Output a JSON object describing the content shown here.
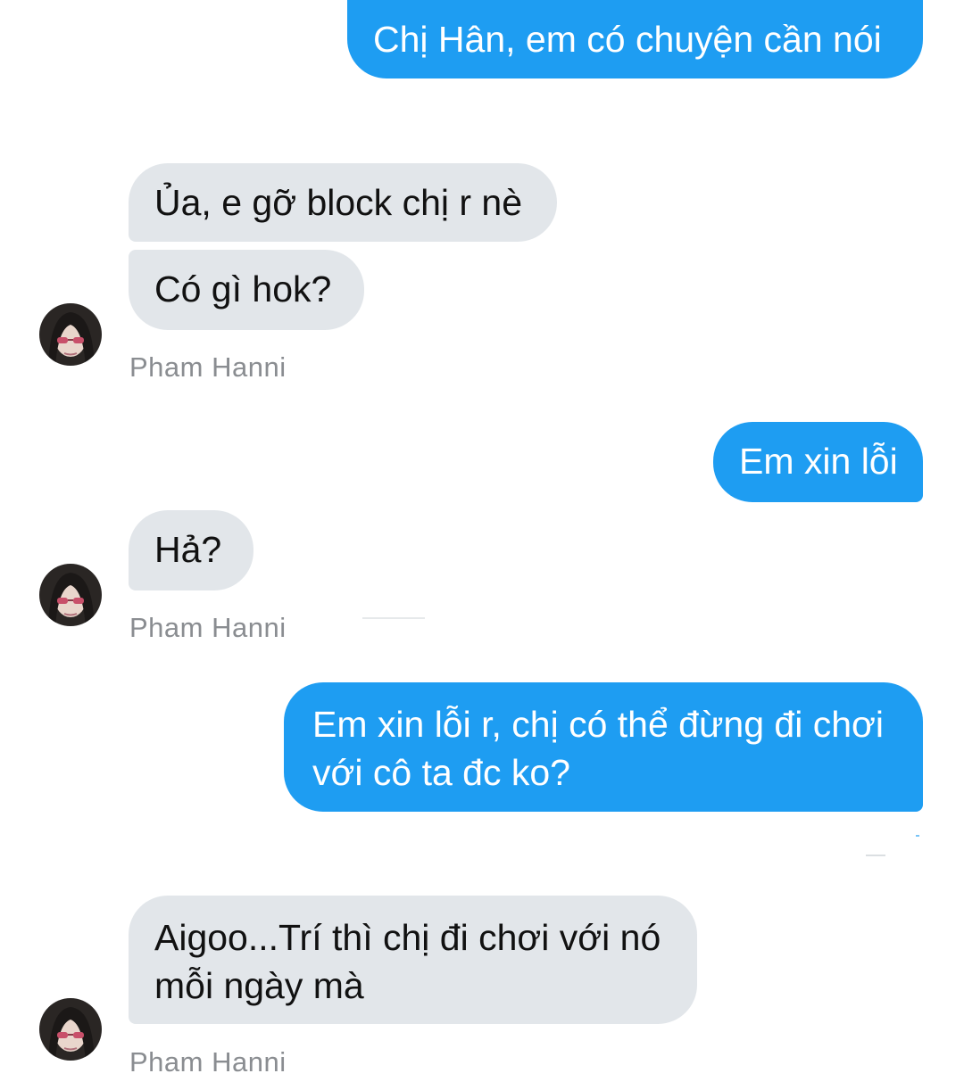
{
  "messages": [
    {
      "id": "m1",
      "direction": "outgoing",
      "text": "Chị Hân, em có chuyện cần nói"
    },
    {
      "id": "m2",
      "direction": "incoming",
      "text": "Ủa, e gỡ block chị r nè"
    },
    {
      "id": "m3",
      "direction": "incoming",
      "text": "Có gì hok?"
    },
    {
      "id": "m4",
      "direction": "outgoing",
      "text": "Em xin lỗi"
    },
    {
      "id": "m5",
      "direction": "incoming",
      "text": "Hả?"
    },
    {
      "id": "m6",
      "direction": "outgoing",
      "lines": [
        "Em xin lỗi r, chị có thể đừng đi chơi",
        "với cô ta đc ko?"
      ]
    },
    {
      "id": "m7",
      "direction": "incoming",
      "lines": [
        "Aigoo...Trí thì chị đi chơi với nó",
        "mỗi ngày mà"
      ]
    }
  ],
  "sender_labels": [
    "Pham Hanni",
    "Pham Hanni",
    "Pham Hanni"
  ],
  "colors": {
    "outgoing_bubble": "#1e9df2",
    "incoming_bubble": "#e2e6ea",
    "sender_label": "#8a8d91"
  },
  "icons": {
    "avatar": "contact-avatar-photo"
  }
}
